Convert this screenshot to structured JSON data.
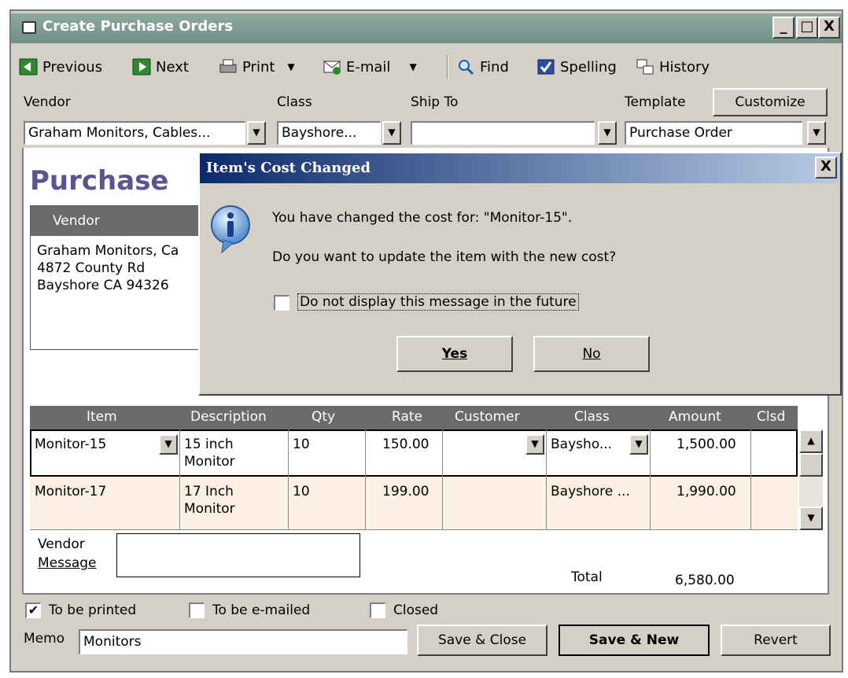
{
  "window": {
    "title": "Create Purchase Orders",
    "controls": {
      "minimize": "_",
      "maximize": "□",
      "close": "X"
    }
  },
  "toolbar": {
    "previous": "Previous",
    "next": "Next",
    "print": "Print",
    "email": "E-mail",
    "find": "Find",
    "spelling": "Spelling",
    "history": "History"
  },
  "header": {
    "vendor_label": "Vendor",
    "vendor_value": "Graham Monitors, Cables...",
    "class_label": "Class",
    "class_value": "Bayshore...",
    "shipto_label": "Ship To",
    "shipto_value": "",
    "template_label": "Template",
    "template_value": "Purchase Order",
    "customize_label": "Customize"
  },
  "form": {
    "title": "Purchase",
    "vendor_box_label": "Vendor",
    "vendor_address": "Graham Monitors, Ca\n4872 County Rd\nBayshore CA 94326"
  },
  "grid": {
    "columns": [
      "Item",
      "Description",
      "Qty",
      "Rate",
      "Customer",
      "Class",
      "Amount",
      "Clsd"
    ],
    "rows": [
      {
        "item": "Monitor-15",
        "description": "15 inch\nMonitor",
        "qty": "10",
        "rate": "150.00",
        "customer": "",
        "class": "Baysho...",
        "amount": "1,500.00"
      },
      {
        "item": "Monitor-17",
        "description": "17 Inch\nMonitor",
        "qty": "10",
        "rate": "199.00",
        "customer": "",
        "class": "Bayshore ...",
        "amount": "1,990.00"
      }
    ]
  },
  "footer": {
    "vendor_message_label_1": "Vendor",
    "vendor_message_label_2": "Message",
    "total_label": "Total",
    "total_value": "6,580.00",
    "to_be_printed": "To be printed",
    "to_be_printed_checked": true,
    "to_be_emailed": "To be e-mailed",
    "closed": "Closed",
    "memo_label": "Memo",
    "memo_value": "Monitors",
    "save_close": "Save & Close",
    "save_new": "Save & New",
    "revert": "Revert"
  },
  "dialog": {
    "title": "Item's Cost Changed",
    "close": "X",
    "line1": "You have changed the cost for: \"Monitor-15\".",
    "line2": "Do you want to update the item with the new cost?",
    "checkbox_label": "Do not display this message in the future",
    "yes": "Yes",
    "no": "No"
  },
  "colors": {
    "window_title_bg": "#7a9a90",
    "dialog_title_bg": "#0a2a6a",
    "form_title": "#5a5590",
    "grid_header": "#6b6b6b",
    "row_alt": "#fbf0e2"
  }
}
